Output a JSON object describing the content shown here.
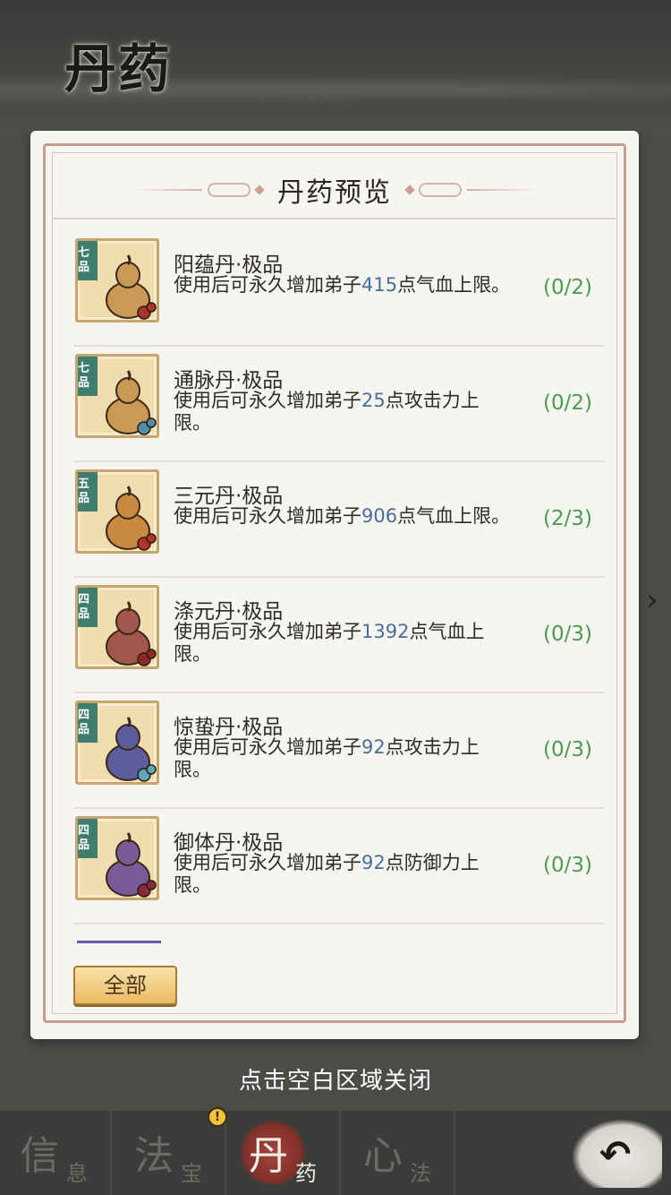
{
  "page": {
    "title": "丹药"
  },
  "dialog": {
    "title": "丹药预览",
    "items": [
      {
        "grade": "七品",
        "name": "阳蕴丹·极品",
        "desc_pre": "使用后可永久增加弟子",
        "num": "415",
        "desc_post": "点气血上限。",
        "count": "(0/2)",
        "gourd_color": "#c89a55",
        "bead_color": "#a8352a"
      },
      {
        "grade": "七品",
        "name": "通脉丹·极品",
        "desc_pre": "使用后可永久增加弟子",
        "num": "25",
        "desc_post": "点攻击力上限。",
        "count": "(0/2)",
        "gourd_color": "#c89a55",
        "bead_color": "#4f8fa5"
      },
      {
        "grade": "五品",
        "name": "三元丹·极品",
        "desc_pre": "使用后可永久增加弟子",
        "num": "906",
        "desc_post": "点气血上限。",
        "count": "(2/3)",
        "gourd_color": "#c98a3f",
        "bead_color": "#b3322a"
      },
      {
        "grade": "四品",
        "name": "涤元丹·极品",
        "desc_pre": "使用后可永久增加弟子",
        "num": "1392",
        "desc_post": "点气血上限。",
        "count": "(0/3)",
        "gourd_color": "#a3564c",
        "bead_color": "#8e2a24"
      },
      {
        "grade": "四品",
        "name": "惊蛰丹·极品",
        "desc_pre": "使用后可永久增加弟子",
        "num": "92",
        "desc_post": "点攻击力上限。",
        "count": "(0/3)",
        "gourd_color": "#5b5d9c",
        "bead_color": "#5fa6b8"
      },
      {
        "grade": "四品",
        "name": "御体丹·极品",
        "desc_pre": "使用后可永久增加弟子",
        "num": "92",
        "desc_post": "点防御力上限。",
        "count": "(0/3)",
        "gourd_color": "#7a5a98",
        "bead_color": "#8b2a3a"
      }
    ],
    "filter_button": "全部"
  },
  "close_hint": "点击空白区域关闭",
  "tabs": [
    {
      "big": "信",
      "small": "息",
      "active": false
    },
    {
      "big": "法",
      "small": "宝",
      "active": false
    },
    {
      "big": "丹",
      "small": "药",
      "active": true
    },
    {
      "big": "心",
      "small": "法",
      "active": false
    }
  ],
  "badge": "!",
  "back_icon": "back-arrow-icon"
}
